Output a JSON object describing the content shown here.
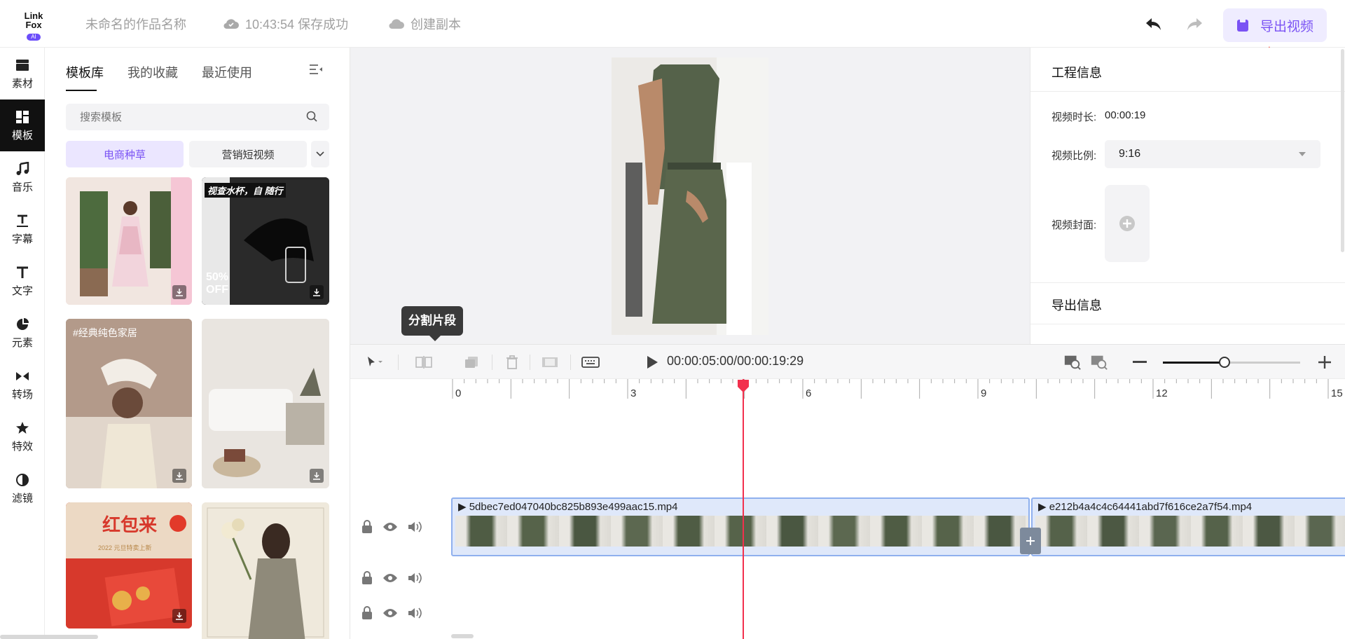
{
  "app": {
    "logo": {
      "line1": "Link",
      "line2": "Fox",
      "badge": "AI"
    },
    "project_name": "未命名的作品名称",
    "save_status": "10:43:54 保存成功",
    "create_copy": "创建副本",
    "export_label": "导出视频",
    "accent_color": "#7a52f4"
  },
  "nav": {
    "items": [
      {
        "label": "素材",
        "icon": "folder-icon"
      },
      {
        "label": "模板",
        "icon": "template-icon"
      },
      {
        "label": "音乐",
        "icon": "music-icon"
      },
      {
        "label": "字幕",
        "icon": "subtitle-icon"
      },
      {
        "label": "文字",
        "icon": "text-icon"
      },
      {
        "label": "元素",
        "icon": "element-icon"
      },
      {
        "label": "转场",
        "icon": "transition-icon"
      },
      {
        "label": "特效",
        "icon": "effect-icon"
      },
      {
        "label": "滤镜",
        "icon": "filter-icon"
      }
    ],
    "active": "模板"
  },
  "templates": {
    "tabs": [
      "模板库",
      "我的收藏",
      "最近使用"
    ],
    "active_tab": "模板库",
    "search_placeholder": "搜索模板",
    "chips": [
      "电商种草",
      "营销短视频"
    ],
    "active_chip": "电商种草",
    "thumb_texts": {
      "t2_banner": "视查水杯，自  随行",
      "t2_sale1": "50%",
      "t2_sale2": "OFF",
      "t3_tag": "#经典纯色家居",
      "t5_title": "红包来",
      "t5_sub": "2022 元旦特卖上新"
    }
  },
  "tooltip": "分割片段",
  "project_info": {
    "title": "工程信息",
    "duration_label": "视频时长:",
    "duration_value": "00:00:19",
    "ratio_label": "视频比例:",
    "ratio_value": "9:16",
    "cover_label": "视频封面:",
    "export_info_title": "导出信息"
  },
  "toolbar": {
    "timecode": "00:00:05:00/00:00:19:29",
    "zoom_level": 0.45
  },
  "timeline": {
    "ticks": [
      "0",
      "3",
      "6",
      "9",
      "12",
      "15"
    ],
    "playhead_seconds": 4.0,
    "clips": [
      {
        "name": "5dbec7ed047040bc825b893e499aac15.mp4"
      },
      {
        "name": "e212b4a4c4c64441abd7f616ce2a7f54.mp4"
      }
    ]
  }
}
